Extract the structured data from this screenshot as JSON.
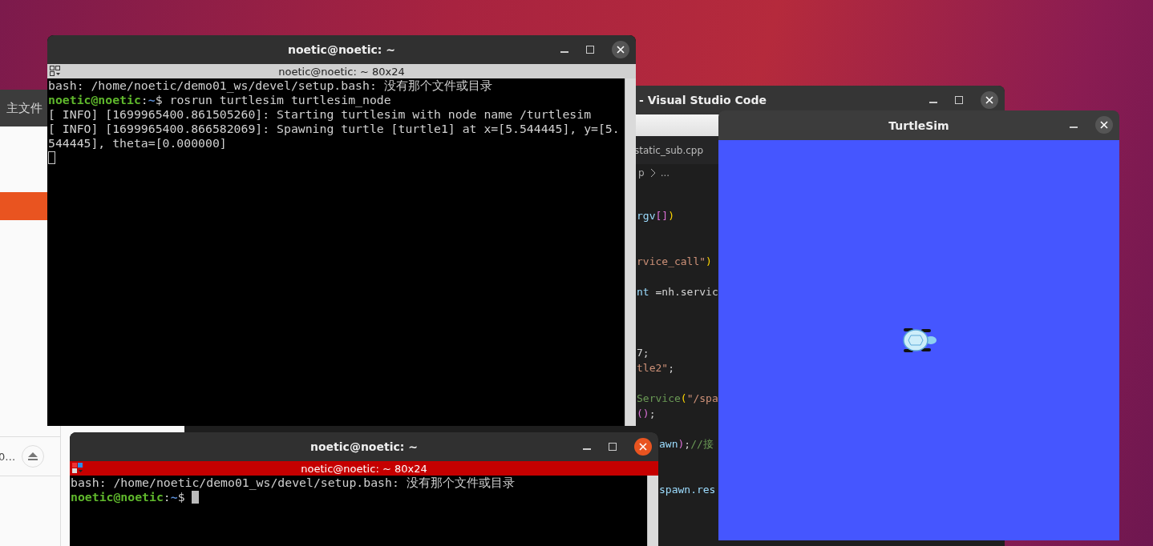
{
  "file_manager": {
    "title": "主文件",
    "items": [
      {
        "kind": "place",
        "selected": true
      },
      {
        "kind": "device",
        "label": "0…",
        "selected": false
      }
    ]
  },
  "vscode": {
    "title": "- Visual Studio Code",
    "tab": "static_sub.cpp",
    "breadcrumb": [
      "p",
      "..."
    ],
    "code_lines": [
      {
        "kind": "code",
        "segments": [
          {
            "kind": "var",
            "text": "rgv"
          },
          {
            "kind": "bracket",
            "text": "[]"
          },
          {
            "kind": "paren",
            "text": ")"
          }
        ]
      },
      {
        "kind": "blank"
      },
      {
        "kind": "blank"
      },
      {
        "kind": "code",
        "segments": [
          {
            "kind": "string",
            "text": "rvice_call\""
          },
          {
            "kind": "paren",
            "text": ")"
          }
        ]
      },
      {
        "kind": "blank"
      },
      {
        "kind": "code",
        "segments": [
          {
            "kind": "var",
            "text": "nt "
          },
          {
            "kind": "plain",
            "text": "=nh.servic"
          }
        ]
      },
      {
        "kind": "blank"
      },
      {
        "kind": "blank"
      },
      {
        "kind": "blank"
      },
      {
        "kind": "code",
        "segments": [
          {
            "kind": "plain",
            "text": "7;"
          }
        ]
      },
      {
        "kind": "code",
        "segments": [
          {
            "kind": "string",
            "text": "tle2\""
          },
          {
            "kind": "plain",
            "text": ";"
          }
        ]
      },
      {
        "kind": "blank"
      },
      {
        "kind": "code",
        "segments": [
          {
            "kind": "type",
            "text": "Service"
          },
          {
            "kind": "paren",
            "text": "("
          },
          {
            "kind": "string",
            "text": "\"/spa"
          }
        ]
      },
      {
        "kind": "code",
        "segments": [
          {
            "kind": "bracket",
            "text": "()"
          },
          {
            "kind": "plain",
            "text": ";"
          }
        ]
      },
      {
        "kind": "blank"
      },
      {
        "kind": "code",
        "segments": [
          {
            "kind": "var",
            "text": "awn"
          },
          {
            "kind": "bracket",
            "text": ")"
          },
          {
            "kind": "plain",
            "text": ";"
          },
          {
            "kind": "comment",
            "text": "//接"
          }
        ]
      },
      {
        "kind": "blank"
      },
      {
        "kind": "blank"
      },
      {
        "kind": "code",
        "segments": [
          {
            "kind": "var",
            "text": "spawn.res"
          }
        ]
      }
    ]
  },
  "terminals": [
    {
      "title": "noetic@noetic: ~",
      "subtitle": "noetic@noetic: ~ 80x24",
      "focused": false,
      "lines": [
        [
          {
            "kind": "text",
            "text": "bash: /home/noetic/demo01_ws/devel/setup.bash: 没有那个文件或目录"
          }
        ],
        [
          {
            "kind": "user",
            "text": "noetic@noetic"
          },
          {
            "kind": "text",
            "text": ":"
          },
          {
            "kind": "path",
            "text": "~"
          },
          {
            "kind": "text",
            "text": "$ rosrun turtlesim turtlesim_node"
          }
        ],
        [
          {
            "kind": "text",
            "text": "[ INFO] [1699965400.861505260]: Starting turtlesim with node name /turtlesim"
          }
        ],
        [
          {
            "kind": "text",
            "text": "[ INFO] [1699965400.866582069]: Spawning turtle [turtle1] at x=[5.544445], y=[5."
          }
        ],
        [
          {
            "kind": "text",
            "text": "544445], theta=[0.000000]"
          }
        ],
        [
          {
            "kind": "cursor"
          }
        ]
      ]
    },
    {
      "title": "noetic@noetic: ~",
      "subtitle": "noetic@noetic: ~ 80x24",
      "focused": true,
      "lines": [
        [
          {
            "kind": "text",
            "text": "bash: /home/noetic/demo01_ws/devel/setup.bash: 没有那个文件或目录"
          }
        ],
        [
          {
            "kind": "user",
            "text": "noetic@noetic"
          },
          {
            "kind": "text",
            "text": ":"
          },
          {
            "kind": "path",
            "text": "~"
          },
          {
            "kind": "text",
            "text": "$ "
          },
          {
            "kind": "cursor"
          }
        ]
      ]
    }
  ],
  "turtlesim": {
    "title": "TurtleSim"
  }
}
